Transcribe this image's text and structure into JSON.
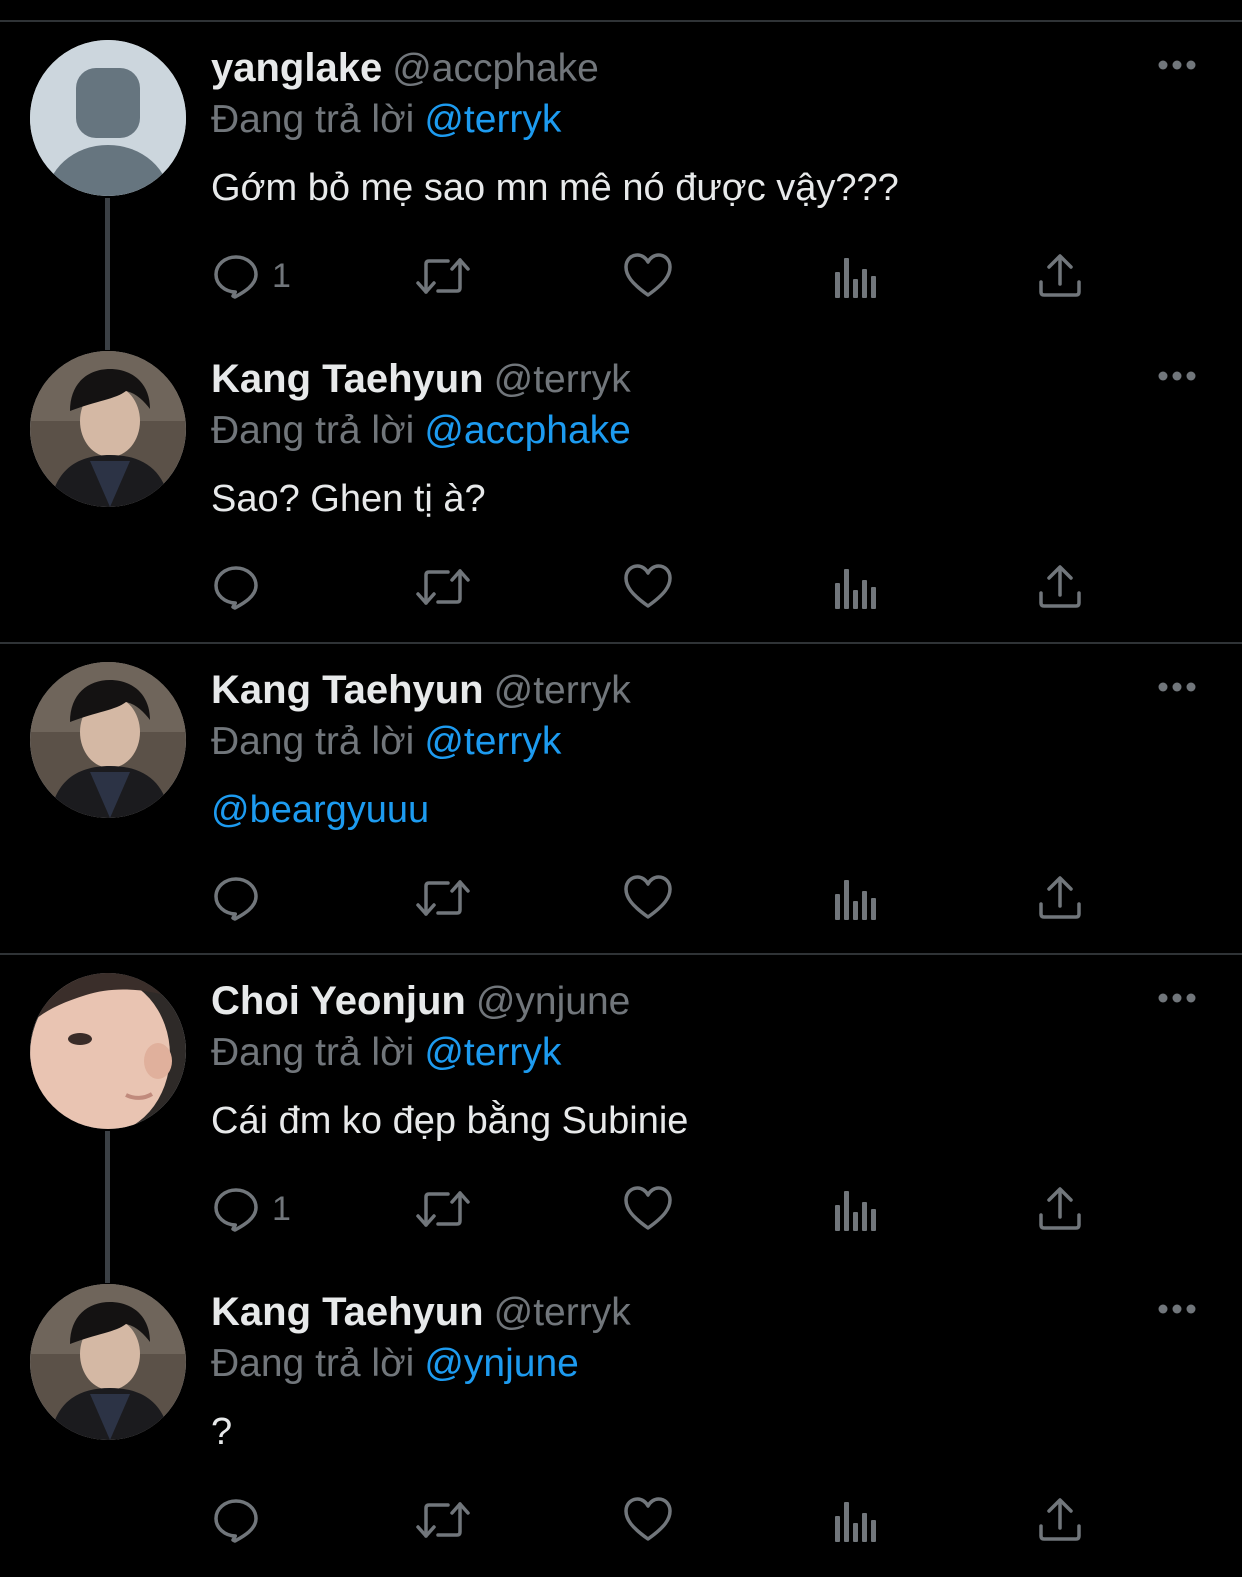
{
  "colors": {
    "background": "#000000",
    "text": "#e7e9ea",
    "muted": "#71767b",
    "accent": "#1d9bf0",
    "divider": "#2f3336"
  },
  "reply_label": "Đang trả lời",
  "tweets": [
    {
      "display_name": "yanglake",
      "handle": "@accphake",
      "replying_to": "@terryk",
      "text": "Gớm bỏ mẹ sao mn mê nó được vậy???",
      "reply_count": "1",
      "avatar": "default-avatar-icon"
    },
    {
      "display_name": "Kang Taehyun",
      "handle": "@terryk",
      "replying_to": "@accphake",
      "text": "Sao? Ghen tị à?",
      "reply_count": "",
      "avatar": "profile-photo"
    },
    {
      "display_name": "Kang Taehyun",
      "handle": "@terryk",
      "replying_to": "@terryk",
      "text": "@beargyuuu",
      "reply_count": "",
      "avatar": "profile-photo"
    },
    {
      "display_name": "Choi Yeonjun",
      "handle": "@ynjune",
      "replying_to": "@terryk",
      "text": "Cái đm ko đẹp bằng Subinie",
      "reply_count": "1",
      "avatar": "profile-photo"
    },
    {
      "display_name": "Kang Taehyun",
      "handle": "@terryk",
      "replying_to": "@ynjune",
      "text": "?",
      "reply_count": "",
      "avatar": "profile-photo"
    }
  ]
}
